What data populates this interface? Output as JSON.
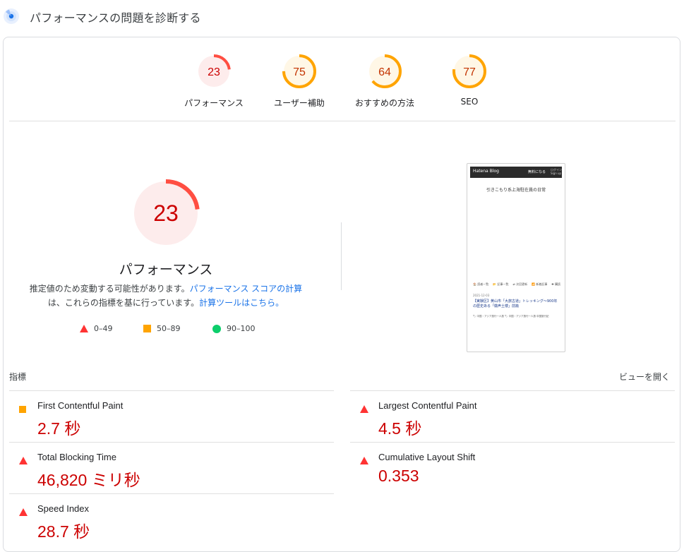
{
  "header": {
    "title": "パフォーマンスの問題を診断する",
    "icon": "lighthouse-icon"
  },
  "gauges": [
    {
      "label": "パフォーマンス",
      "score": "23",
      "value": 23,
      "ring": "#ff4e42",
      "fill": "#fdecec",
      "text": "#c00"
    },
    {
      "label": "ユーザー補助",
      "score": "75",
      "value": 75,
      "ring": "#ffa400",
      "fill": "#fff7e6",
      "text": "#c33300"
    },
    {
      "label": "おすすめの方法",
      "score": "64",
      "value": 64,
      "ring": "#ffa400",
      "fill": "#fff7e6",
      "text": "#c33300"
    },
    {
      "label": "SEO",
      "score": "77",
      "value": 77,
      "ring": "#ffa400",
      "fill": "#fff7e6",
      "text": "#c33300"
    }
  ],
  "main_score": {
    "score": "23",
    "value": 23,
    "title": "パフォーマンス",
    "desc_1": "推定値のため変動する可能性があります。",
    "desc_link_1": "パフォーマンス スコアの計算",
    "desc_2": "は、これらの指標を基に行っています。",
    "desc_link_2": "計算ツールはこちら。"
  },
  "legend": {
    "fail": "0–49",
    "average": "50–89",
    "pass": "90–100"
  },
  "thumbnail": {
    "logo": "Hatena Blog",
    "button": "無料になる",
    "login": "ログイン Sign up",
    "blog_title": "引きこもり系上海駐在員の日常",
    "nav": [
      "🏠 読者一覧",
      "📂 記事一覧",
      "⇄ 次回更新",
      "📶 新着記事",
      "✚ 購読"
    ],
    "date": "2021-12-03",
    "post": "【実験区】黄山市「大旅古道」トレッキング～900年の歴史ある「徽声土楼」前篇",
    "tags": "🏷 中国・アジア旅行一人旅 🏷 中国・アジア旅行一人旅 中国旅行記"
  },
  "metrics_header": {
    "label": "指標",
    "toggle": "ビューを開く"
  },
  "metrics_left": [
    {
      "name": "First Contentful Paint",
      "value": "2.7 秒",
      "status": "average"
    },
    {
      "name": "Total Blocking Time",
      "value": "46,820 ミリ秒",
      "status": "fail"
    },
    {
      "name": "Speed Index",
      "value": "28.7 秒",
      "status": "fail"
    }
  ],
  "metrics_right": [
    {
      "name": "Largest Contentful Paint",
      "value": "4.5 秒",
      "status": "fail"
    },
    {
      "name": "Cumulative Layout Shift",
      "value": "0.353",
      "status": "fail"
    }
  ]
}
